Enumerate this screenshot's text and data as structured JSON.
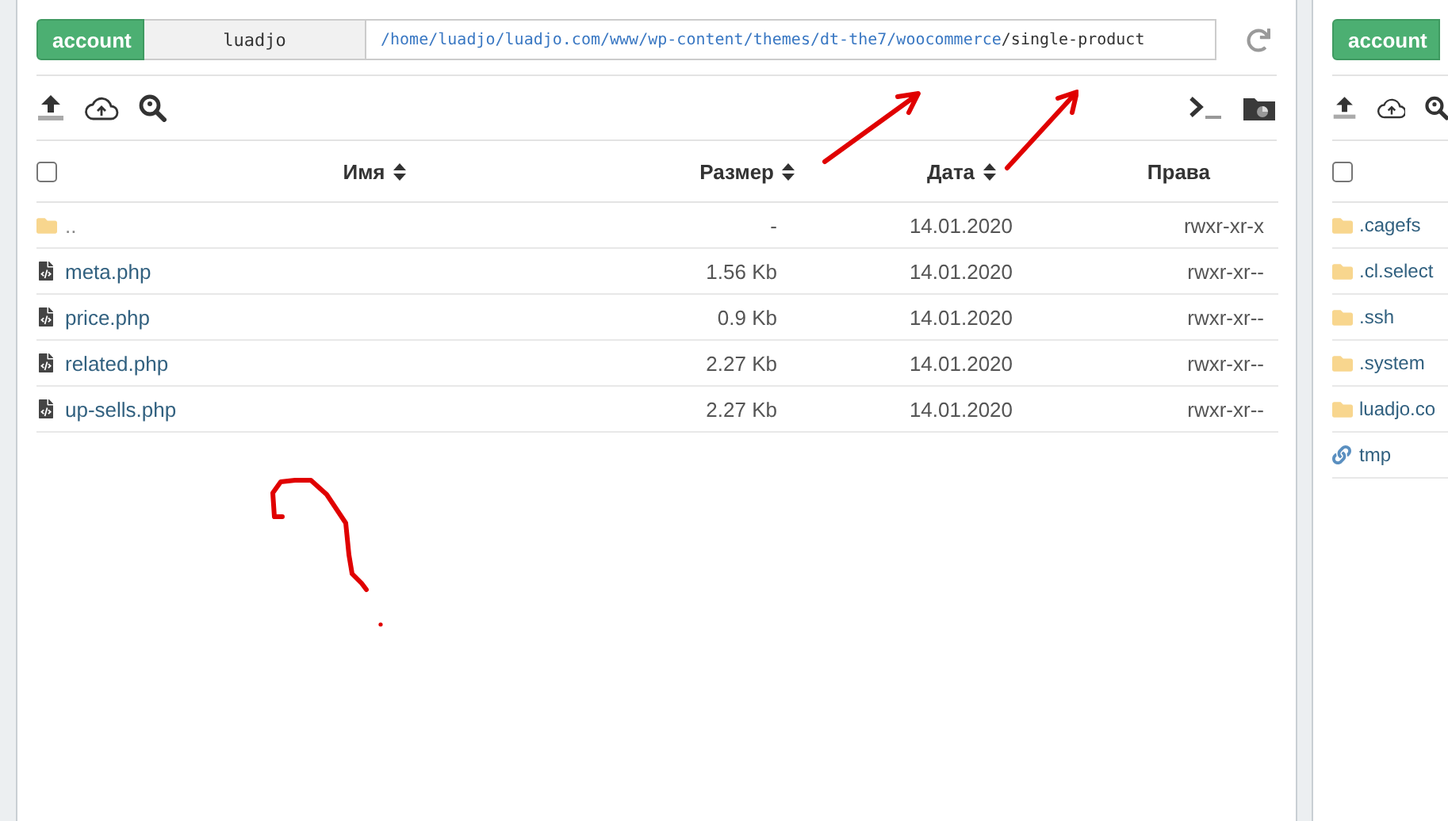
{
  "left_panel": {
    "account_button": "account",
    "user": "luadjo",
    "path": {
      "links": [
        "/home",
        "/luadjo",
        "/luadjo.com",
        "/www",
        "/wp-content",
        "/themes",
        "/dt-the7",
        "/woocommerce"
      ],
      "current": "/single-product"
    },
    "select_all": {
      "checked": false
    },
    "columns": [
      {
        "label": "Имя",
        "sortable": true
      },
      {
        "label": "Размер",
        "sortable": true
      },
      {
        "label": "Дата",
        "sortable": true
      },
      {
        "label": "Права",
        "sortable": false
      }
    ],
    "rows": [
      {
        "kind": "folder",
        "name": "..",
        "size": "-",
        "date": "14.01.2020",
        "permissions": "rwxr-xr-x"
      },
      {
        "kind": "file",
        "name": "meta.php",
        "size": "1.56 Kb",
        "date": "14.01.2020",
        "permissions": "rwxr-xr--"
      },
      {
        "kind": "file",
        "name": "price.php",
        "size": "0.9 Kb",
        "date": "14.01.2020",
        "permissions": "rwxr-xr--"
      },
      {
        "kind": "file",
        "name": "related.php",
        "size": "2.27 Kb",
        "date": "14.01.2020",
        "permissions": "rwxr-xr--"
      },
      {
        "kind": "file",
        "name": "up-sells.php",
        "size": "2.27 Kb",
        "date": "14.01.2020",
        "permissions": "rwxr-xr--"
      }
    ]
  },
  "right_panel": {
    "account_button": "account",
    "select_all": {
      "checked": false
    },
    "rows": [
      {
        "kind": "folder",
        "name": ".cagefs"
      },
      {
        "kind": "folder",
        "name": ".cl.select"
      },
      {
        "kind": "folder",
        "name": ".ssh"
      },
      {
        "kind": "folder",
        "name": ".system"
      },
      {
        "kind": "folder",
        "name": "luadjo.co"
      },
      {
        "kind": "link",
        "name": "tmp"
      }
    ]
  }
}
